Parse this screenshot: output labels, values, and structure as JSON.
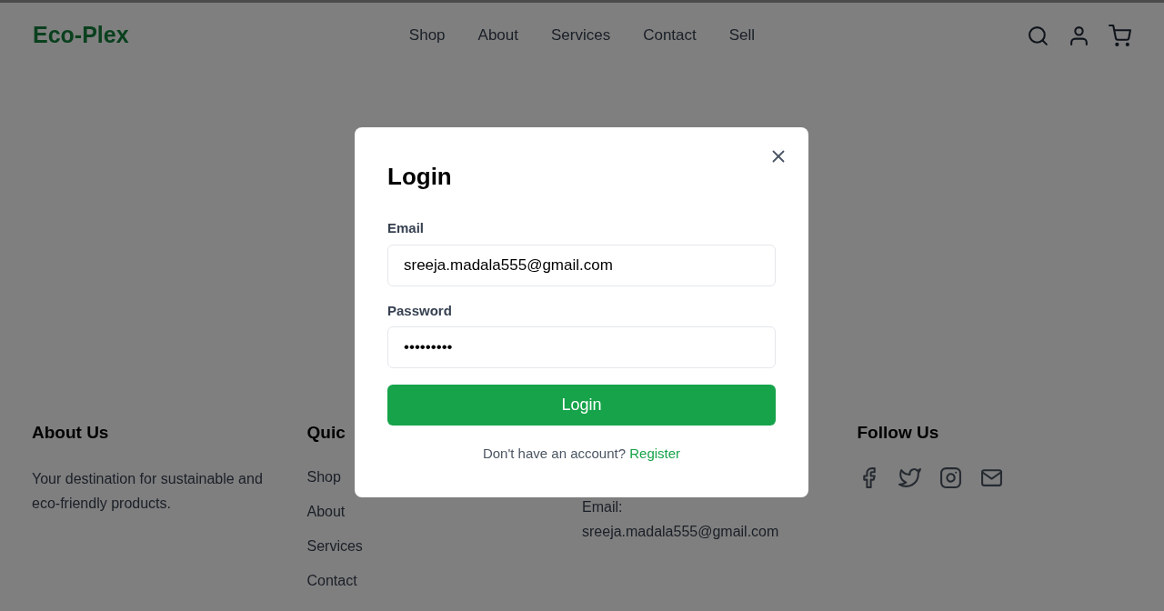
{
  "header": {
    "logo": "Eco-Plex",
    "nav": [
      {
        "label": "Shop"
      },
      {
        "label": "About"
      },
      {
        "label": "Services"
      },
      {
        "label": "Contact"
      },
      {
        "label": "Sell"
      }
    ]
  },
  "footer": {
    "about": {
      "heading": "About Us",
      "text": "Your destination for sustainable and eco-friendly products."
    },
    "quick_links": {
      "heading": "Quic",
      "links": [
        "Shop",
        "About",
        "Services",
        "Contact"
      ]
    },
    "contact": {
      "email_label": "Email:",
      "email": "sreeja.madala555@gmail.com"
    },
    "follow": {
      "heading": "Follow Us",
      "icons": [
        {
          "kind": "facebook"
        },
        {
          "kind": "twitter"
        },
        {
          "kind": "instagram"
        },
        {
          "kind": "mail"
        }
      ]
    }
  },
  "modal": {
    "title": "Login",
    "fields": [
      {
        "label": "Email",
        "value": "sreeja.madala555@gmail.com"
      },
      {
        "label": "Password",
        "value": "•••••••••"
      }
    ],
    "submit": "Login",
    "prompt": "Don't have an account?",
    "link": "Register"
  }
}
